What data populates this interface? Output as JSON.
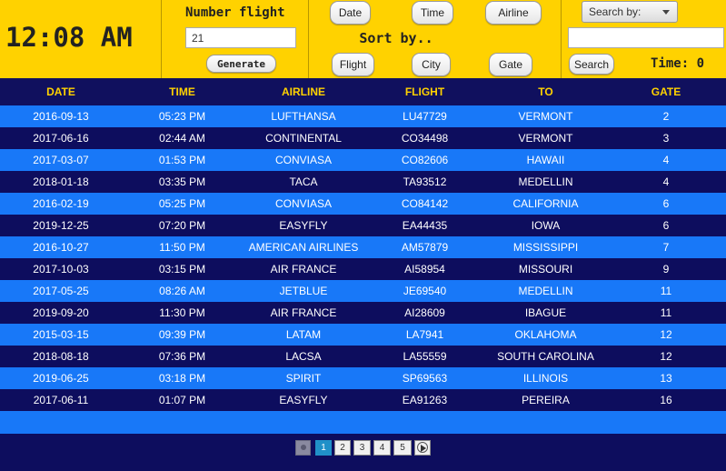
{
  "clock": "12:08 AM",
  "number_flight": {
    "label": "Number flight",
    "value": "21",
    "generate_label": "Generate"
  },
  "sort": {
    "label": "Sort by..",
    "date": "Date",
    "time": "Time",
    "airline": "Airline",
    "flight": "Flight",
    "city": "City",
    "gate": "Gate"
  },
  "search": {
    "by_label": "Search by:",
    "value": "",
    "button_label": "Search",
    "time_label": "Time: 0"
  },
  "table": {
    "headers": [
      "DATE",
      "TIME",
      "AIRLINE",
      "FLIGHT",
      "TO",
      "GATE"
    ],
    "rows": [
      [
        "2016-09-13",
        "05:23 PM",
        "LUFTHANSA",
        "LU47729",
        "VERMONT",
        "2"
      ],
      [
        "2017-06-16",
        "02:44 AM",
        "CONTINENTAL",
        "CO34498",
        "VERMONT",
        "3"
      ],
      [
        "2017-03-07",
        "01:53 PM",
        "CONVIASA",
        "CO82606",
        "HAWAII",
        "4"
      ],
      [
        "2018-01-18",
        "03:35 PM",
        "TACA",
        "TA93512",
        "MEDELLIN",
        "4"
      ],
      [
        "2016-02-19",
        "05:25 PM",
        "CONVIASA",
        "CO84142",
        "CALIFORNIA",
        "6"
      ],
      [
        "2019-12-25",
        "07:20 PM",
        "EASYFLY",
        "EA44435",
        "IOWA",
        "6"
      ],
      [
        "2016-10-27",
        "11:50 PM",
        "AMERICAN AIRLINES",
        "AM57879",
        "MISSISSIPPI",
        "7"
      ],
      [
        "2017-10-03",
        "03:15 PM",
        "AIR FRANCE",
        "AI58954",
        "MISSOURI",
        "9"
      ],
      [
        "2017-05-25",
        "08:26 AM",
        "JETBLUE",
        "JE69540",
        "MEDELLIN",
        "11"
      ],
      [
        "2019-09-20",
        "11:30 PM",
        "AIR FRANCE",
        "AI28609",
        "IBAGUE",
        "11"
      ],
      [
        "2015-03-15",
        "09:39 PM",
        "LATAM",
        "LA7941",
        "OKLAHOMA",
        "12"
      ],
      [
        "2018-08-18",
        "07:36 PM",
        "LACSA",
        "LA55559",
        "SOUTH CAROLINA",
        "12"
      ],
      [
        "2019-06-25",
        "03:18 PM",
        "SPIRIT",
        "SP69563",
        "ILLINOIS",
        "13"
      ],
      [
        "2017-06-11",
        "01:07 PM",
        "EASYFLY",
        "EA91263",
        "PEREIRA",
        "16"
      ]
    ]
  },
  "pagination": {
    "pages": [
      "1",
      "2",
      "3",
      "4",
      "5"
    ],
    "current": "1"
  },
  "colors": {
    "header_bg": "#ffd200",
    "table_dark": "#0d0d5e",
    "table_light": "#1878f8",
    "header_text": "#ffd200"
  }
}
